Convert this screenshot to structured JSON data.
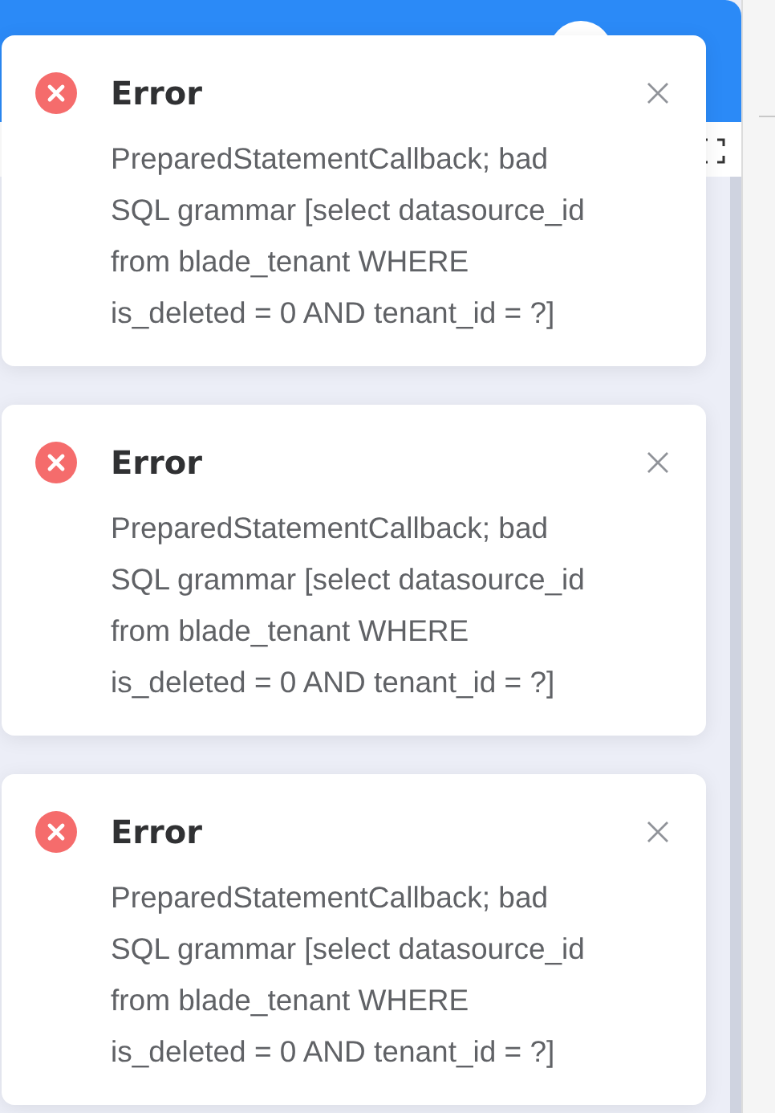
{
  "notifications": [
    {
      "kind": "error",
      "title": "Error",
      "message": "PreparedStatementCallback; bad SQL grammar [select datasource_id from blade_tenant WHERE is_deleted = 0 AND tenant_id = ?]"
    },
    {
      "kind": "error",
      "title": "Error",
      "message": "PreparedStatementCallback; bad SQL grammar [select datasource_id from blade_tenant WHERE is_deleted = 0 AND tenant_id = ?]"
    },
    {
      "kind": "error",
      "title": "Error",
      "message": "PreparedStatementCallback; bad SQL grammar [select datasource_id from blade_tenant WHERE is_deleted = 0 AND tenant_id = ?]"
    }
  ]
}
